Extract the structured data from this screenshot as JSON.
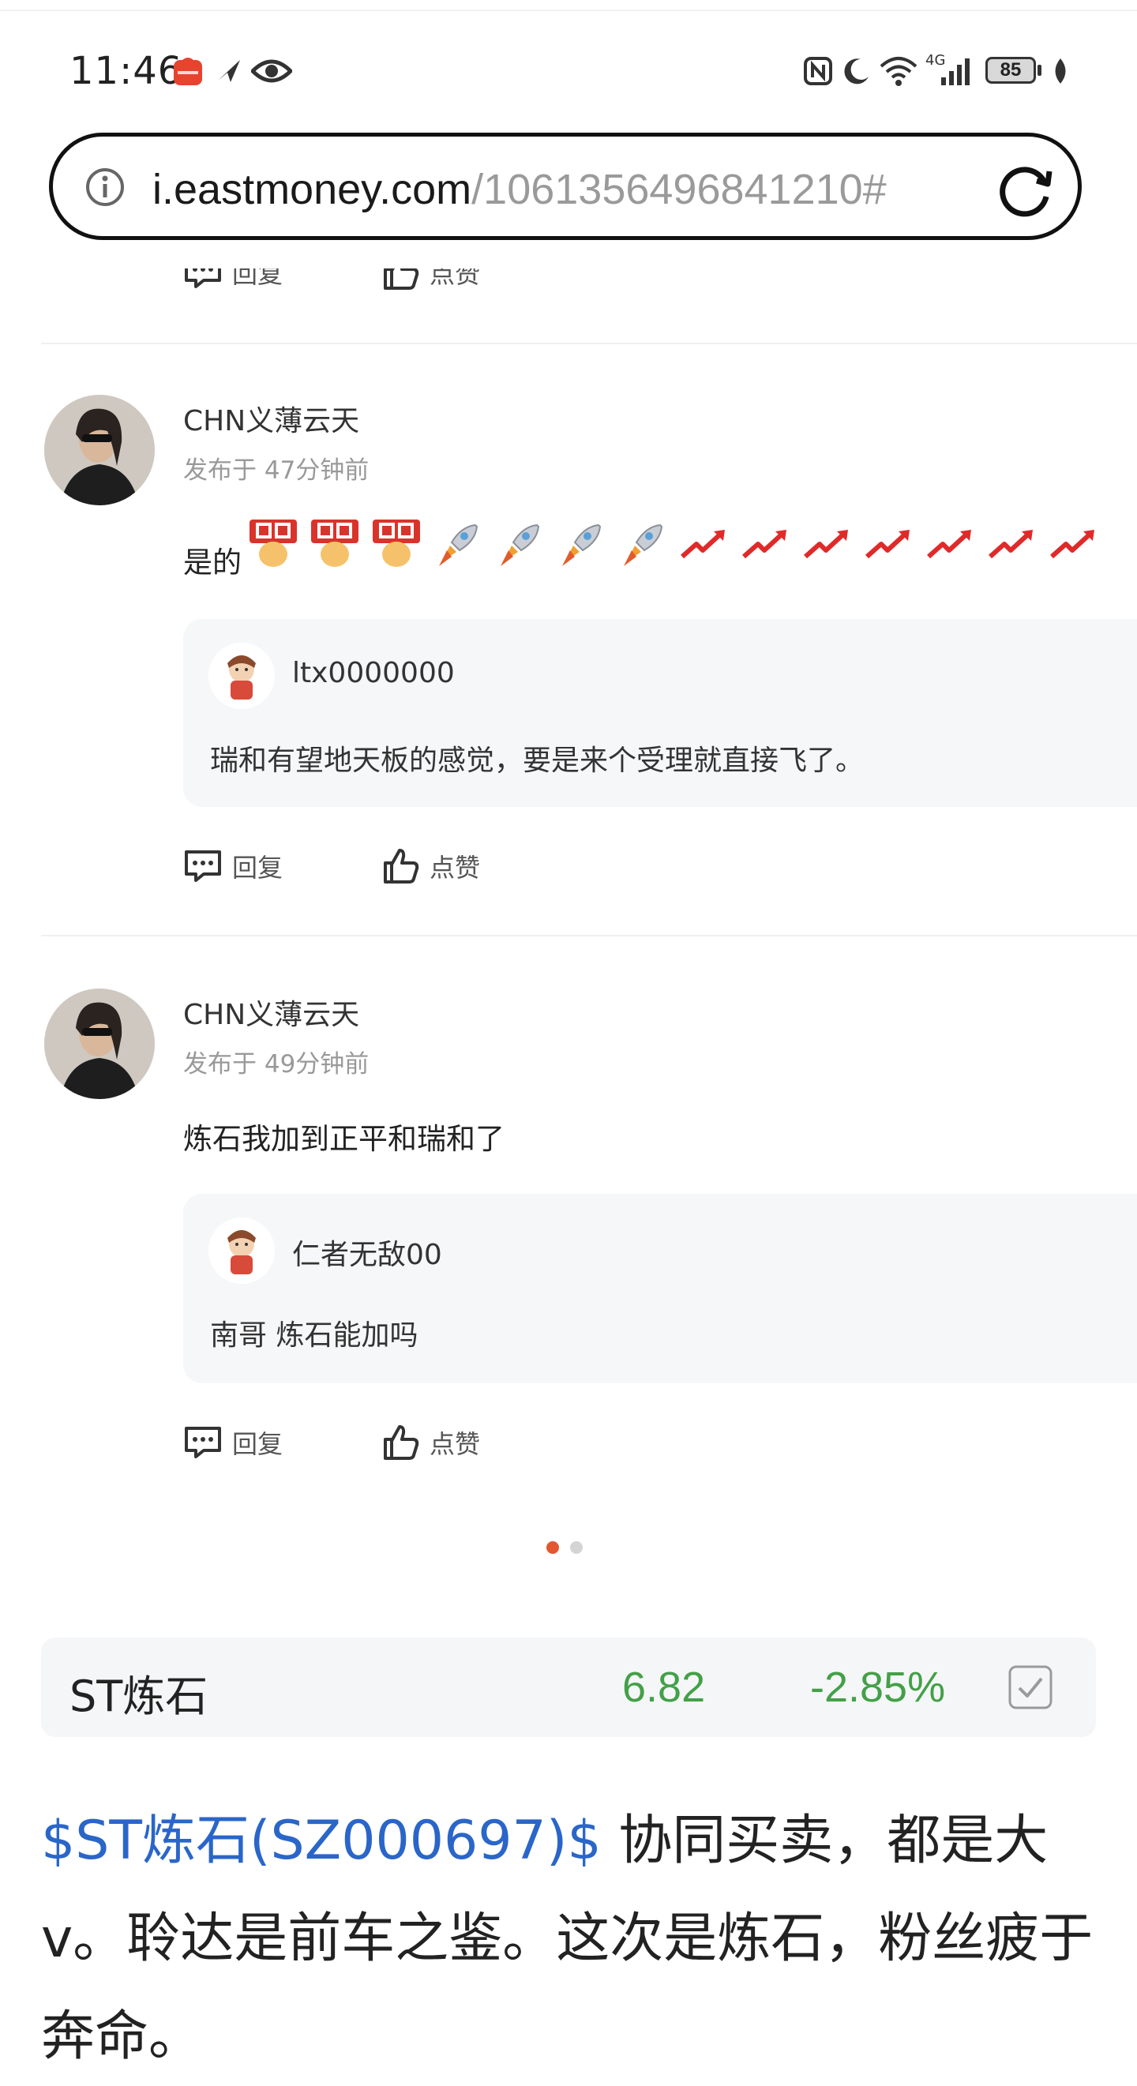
{
  "status_bar": {
    "time": "11:46",
    "battery": "85",
    "network": "4G"
  },
  "url_bar": {
    "host": "i.eastmoney.com",
    "path": "/1061356496841210#"
  },
  "actions": {
    "reply": "回复",
    "like": "点赞"
  },
  "comments": [
    {
      "username": "CHN义薄云天",
      "posted": "发布于 47分钟前",
      "text": "是的",
      "quote": {
        "username": "ltx0000000",
        "text": "瑞和有望地天板的感觉，要是来个受理就直接飞了。"
      }
    },
    {
      "username": "CHN义薄云天",
      "posted": "发布于 49分钟前",
      "text": "炼石我加到正平和瑞和了",
      "quote": {
        "username": "仁者无敌00",
        "text": "南哥 炼石能加吗"
      }
    }
  ],
  "stock": {
    "name": "ST炼石",
    "price": "6.82",
    "change": "-2.85%"
  },
  "article": {
    "tag": "$ST炼石(SZ000697)$",
    "text": " 协同买卖，都是大v。聆达是前车之鉴。这次是炼石，粉丝疲于奔命。"
  },
  "colors": {
    "accent_link": "#2a66c9",
    "stock_green": "#43a047",
    "dot_active": "#e4572e",
    "dot_inactive": "#d4d4d4"
  }
}
